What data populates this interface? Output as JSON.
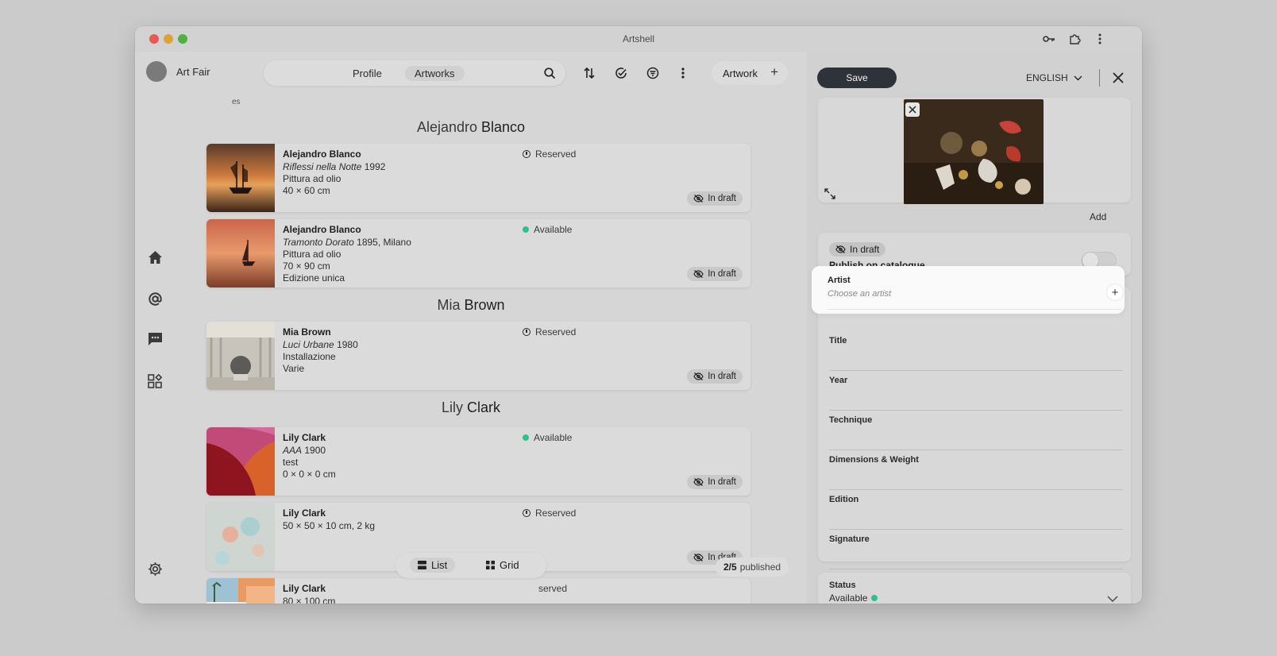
{
  "window": {
    "title": "Artshell"
  },
  "user": {
    "name": "Art Fair",
    "sub": "es"
  },
  "tabs": [
    {
      "label": "Profile",
      "active": false
    },
    {
      "label": "Artworks",
      "active": true
    }
  ],
  "toolbar": {
    "icons": [
      "search-icon",
      "sort-icon",
      "check-circle-icon",
      "filter-icon",
      "more-vertical-icon"
    ],
    "artwork_button": "Artwork"
  },
  "sidebar": {
    "icons": [
      "home-icon",
      "at-icon",
      "chat-icon",
      "apps-icon",
      "settings-icon"
    ]
  },
  "groups": [
    {
      "first": "Alejandro",
      "last": "Blanco"
    },
    {
      "first": "Mia",
      "last": "Brown"
    },
    {
      "first": "Lily",
      "last": "Clark"
    }
  ],
  "cards": [
    {
      "artist": "Alejandro Blanco",
      "title": "Riflessi nella Notte",
      "year": "1992",
      "extra_lines": [
        "Pittura ad olio",
        "40 × 60 cm"
      ],
      "status": "Reserved",
      "draft": "In draft"
    },
    {
      "artist": "Alejandro Blanco",
      "title": "Tramonto Dorato",
      "year": "1895, Milano",
      "extra_lines": [
        "Pittura ad olio",
        "70 × 90 cm",
        "Edizione unica"
      ],
      "status": "Available",
      "draft": "In draft"
    },
    {
      "artist": "Mia Brown",
      "title": "Luci Urbane",
      "year": "1980",
      "extra_lines": [
        "Installazione",
        "Varie"
      ],
      "status": "Reserved",
      "draft": "In draft"
    },
    {
      "artist": "Lily Clark",
      "title": "AAA",
      "year": "1900",
      "extra_lines": [
        "test",
        "0 × 0 × 0 cm"
      ],
      "status": "Available",
      "draft": "In draft"
    },
    {
      "artist": "Lily Clark",
      "title": "",
      "year": "",
      "extra_lines": [
        "50 × 50 × 10 cm, 2 kg"
      ],
      "status": "Reserved",
      "draft": "In draft"
    },
    {
      "artist": "Lily Clark",
      "title": "",
      "year": "",
      "extra_lines": [
        "80 × 100 cm"
      ],
      "status": "served",
      "draft": ""
    }
  ],
  "view": {
    "list": "List",
    "grid": "Grid",
    "active": "List"
  },
  "published": {
    "count": "2/5",
    "label": "published"
  },
  "editor": {
    "save": "Save",
    "language": "ENGLISH",
    "add": "Add",
    "draft_pill": "In draft",
    "publish_label": "Publish on catalogue",
    "artist_label": "Artist",
    "artist_placeholder": "Choose an artist",
    "fields": [
      "Title",
      "Year",
      "Technique",
      "Dimensions & Weight",
      "Edition",
      "Signature"
    ],
    "status_label": "Status",
    "status_value": "Available"
  },
  "colors": {
    "available": "#2ec28a",
    "save_bg": "#2e3339"
  }
}
